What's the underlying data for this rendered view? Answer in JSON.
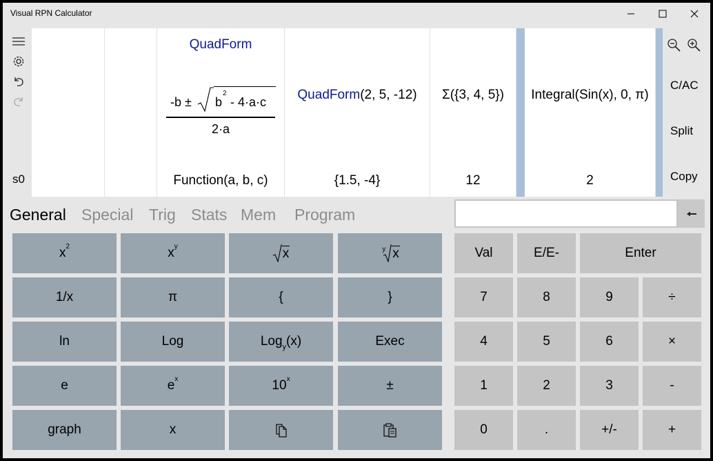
{
  "window": {
    "title": "Visual RPN Calculator",
    "controls": {
      "minimize": "—",
      "maximize": "☐",
      "close": "✕"
    }
  },
  "left_toolbar": {
    "menu_icon": "hamburger-icon",
    "settings_icon": "gear-icon",
    "undo_icon": "undo-icon",
    "redo_icon": "redo-icon",
    "stack_label": "s0"
  },
  "stack": {
    "quad_title": "QuadForm",
    "quad_numerator_a": "-b ±",
    "quad_numerator_b": "b",
    "quad_numerator_b_exp": "2",
    "quad_numerator_c": "- 4·a·c",
    "quad_denominator": "2·a",
    "quad_result": "Function(a, b, c)",
    "call_fn": "QuadForm",
    "call_args": "(2, 5, -12)",
    "call_result": "{1.5, -4}",
    "sum_expr": "Σ({3, 4, 5})",
    "sum_result": "12",
    "integral_expr": "Integral(Sin(x), 0, π)",
    "integral_result": "2"
  },
  "right_toolbar": {
    "zoom_out_icon": "zoom-out-icon",
    "zoom_in_icon": "zoom-in-icon",
    "clear_label": "C/AC",
    "split_label": "Split",
    "copy_label": "Copy"
  },
  "tabs": [
    {
      "label": "General",
      "active": true
    },
    {
      "label": "Special",
      "active": false
    },
    {
      "label": "Trig",
      "active": false
    },
    {
      "label": "Stats",
      "active": false
    },
    {
      "label": "Mem",
      "active": false
    },
    {
      "label": "Program",
      "active": false
    }
  ],
  "entry": {
    "value": "",
    "backspace_icon": "backspace-arrow-icon"
  },
  "function_keys": {
    "square_base": "x",
    "square_exp": "2",
    "power_base": "x",
    "power_exp": "y",
    "sqrt_arg": "x",
    "yroot_index": "y",
    "yroot_arg": "x",
    "reciprocal": "1/x",
    "pi": "π",
    "brace_open": "{",
    "brace_close": "}",
    "ln": "ln",
    "log": "Log",
    "logy_base": "Log",
    "logy_sub": "y",
    "logy_arg": "(x)",
    "exec": "Exec",
    "e": "e",
    "exp_base": "e",
    "exp_exp": "x",
    "ten_base": "10",
    "ten_exp": "x",
    "plusminus": "±",
    "graph": "graph",
    "var_x": "x",
    "copy_icon": "copy-icon",
    "paste_icon": "paste-icon"
  },
  "numpad": {
    "val": "Val",
    "ee": "E/E-",
    "enter": "Enter",
    "n7": "7",
    "n8": "8",
    "n9": "9",
    "divide": "÷",
    "n4": "4",
    "n5": "5",
    "n6": "6",
    "multiply": "×",
    "n1": "1",
    "n2": "2",
    "n3": "3",
    "minus": "-",
    "n0": "0",
    "dot": ".",
    "negate": "+/-",
    "plus": "+"
  },
  "colors": {
    "function_key": "#98a4ae",
    "number_key": "#c4c4c4",
    "function_name": "#0d1a8c",
    "selection_bar": "#a8bfd8"
  }
}
